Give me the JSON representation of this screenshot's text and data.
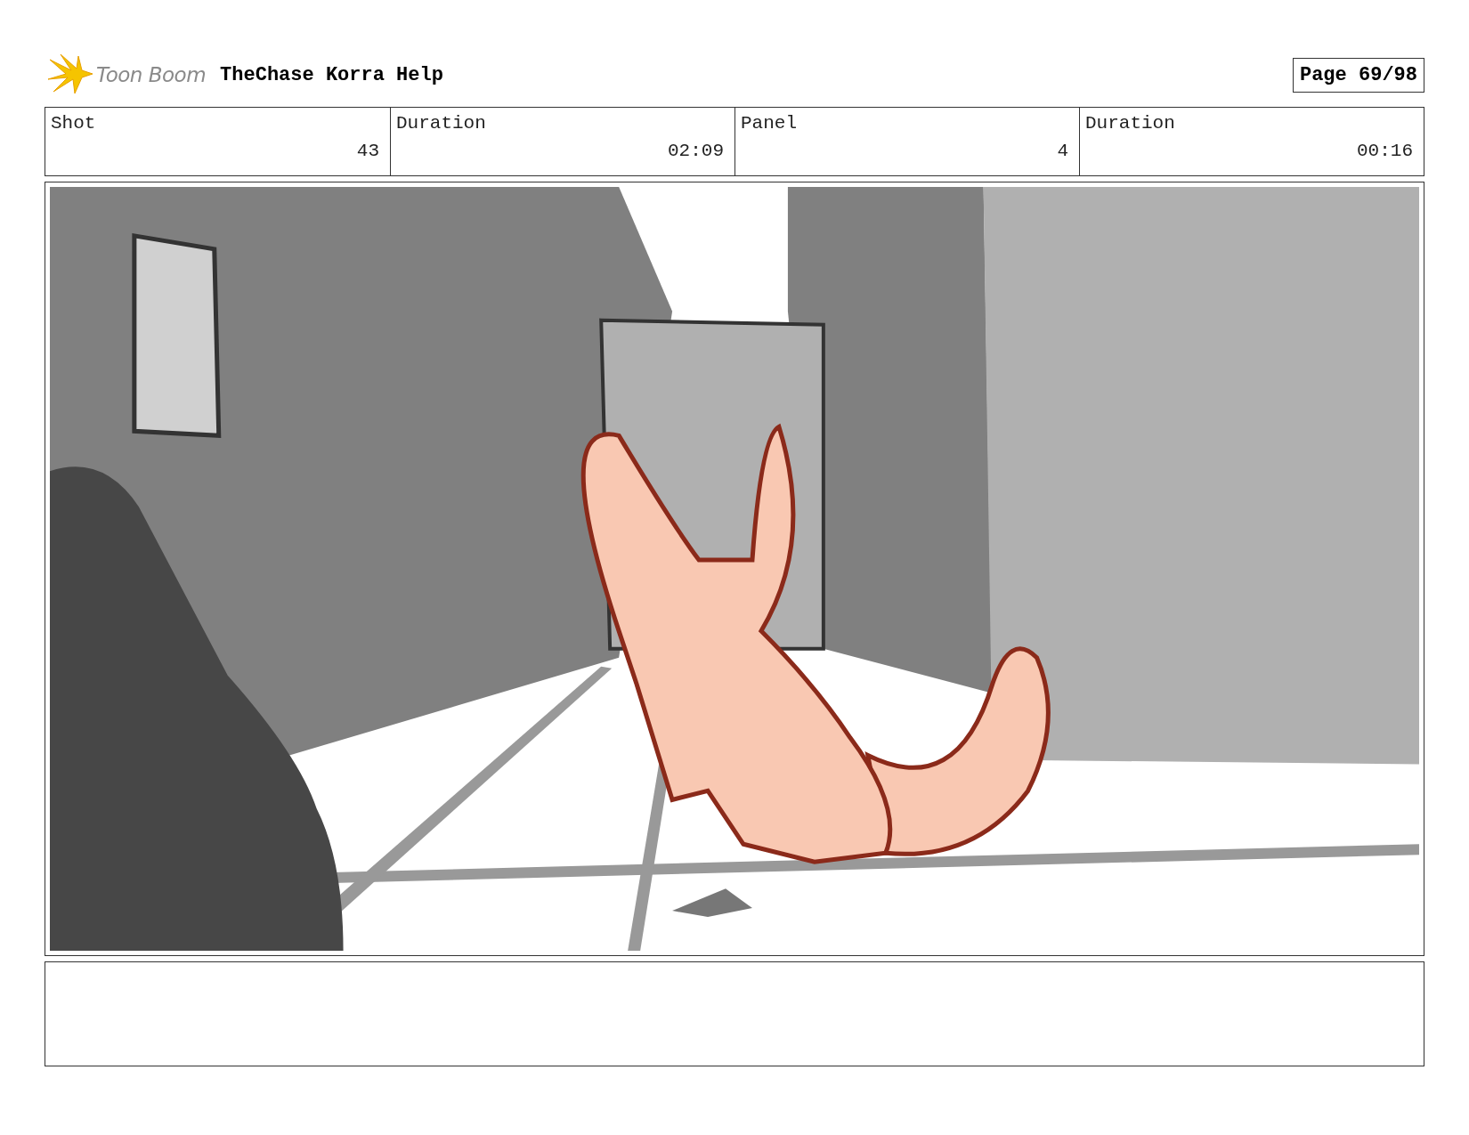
{
  "header": {
    "logo_text": "Toon Boom",
    "title": "TheChase Korra Help",
    "page": "Page 69/98"
  },
  "fields": [
    {
      "label": "Shot",
      "value": "43"
    },
    {
      "label": "Duration",
      "value": "02:09"
    },
    {
      "label": "Panel",
      "value": "4"
    },
    {
      "label": "Duration",
      "value": "00:16"
    }
  ]
}
